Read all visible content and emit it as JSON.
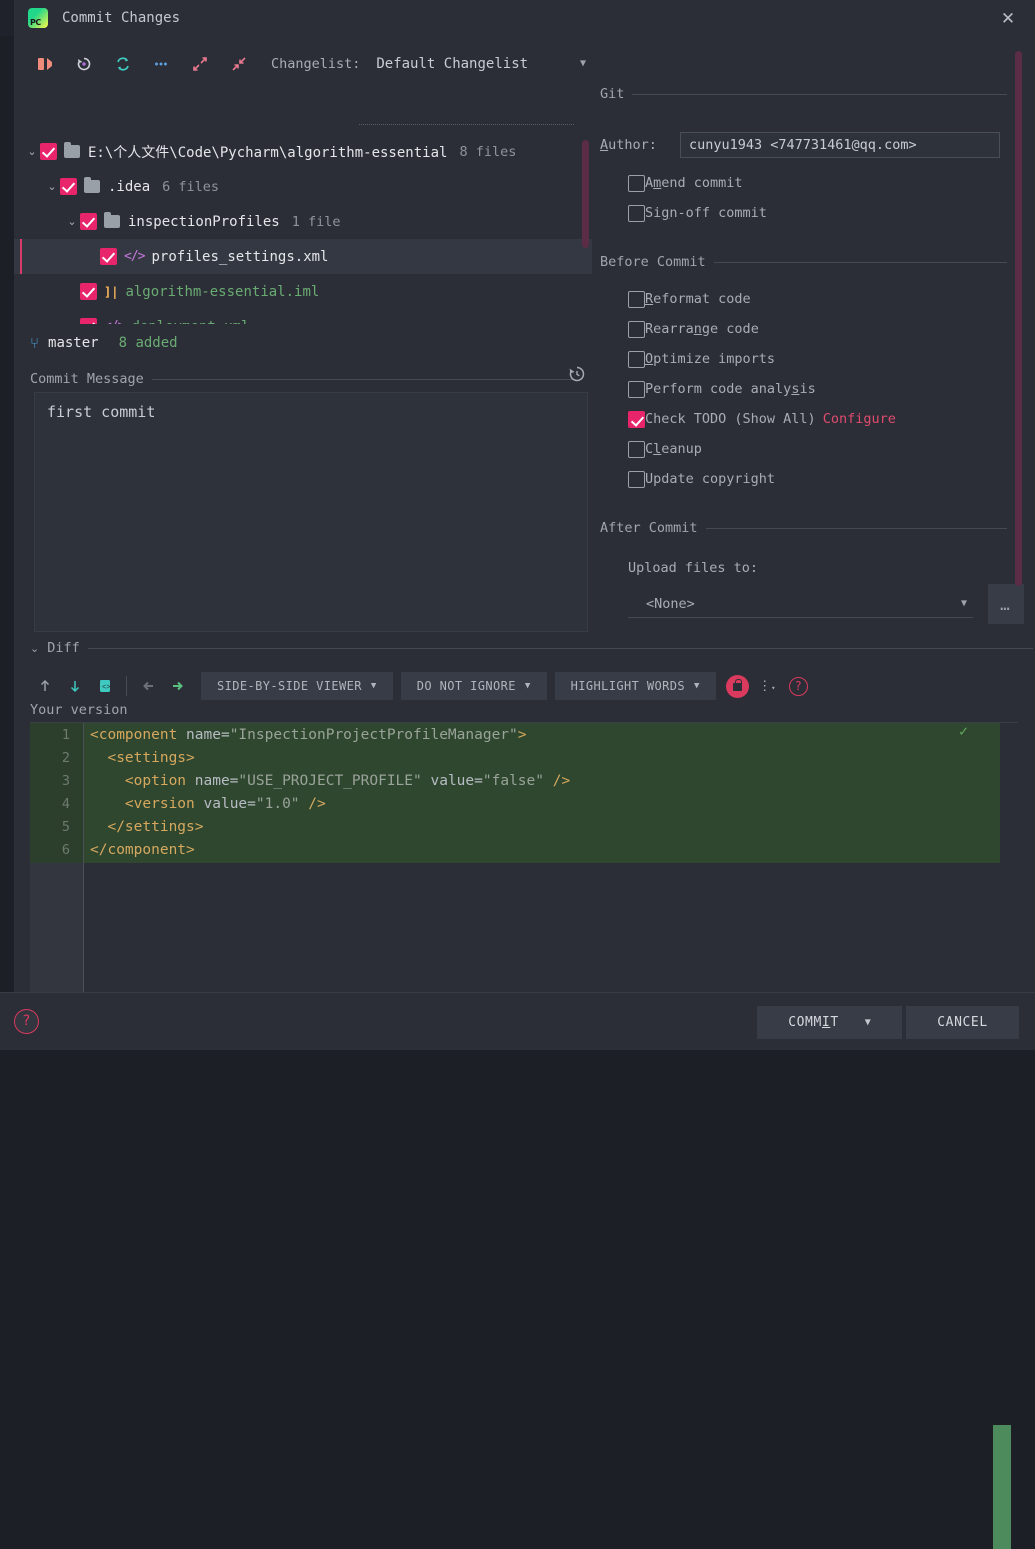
{
  "window": {
    "title": "Commit Changes",
    "app_icon": "pycharm-logo",
    "close_icon": "✕"
  },
  "toolbar": {
    "icons": [
      "show-diff-icon",
      "revert-icon",
      "refresh-icon",
      "more-icon",
      "expand-all-icon",
      "collapse-all-icon"
    ],
    "changelist_label": "Changelist:",
    "changelist_value": "Default Changelist",
    "caret": "▼"
  },
  "tree": {
    "rows": [
      {
        "arrow": "⌄",
        "icon": "folder-icon",
        "label": "E:\\个人文件\\Code\\Pycharm\\algorithm-essential",
        "count": "8 files",
        "indent": 0,
        "checked": true,
        "selected": false,
        "style": "white"
      },
      {
        "arrow": "⌄",
        "icon": "folder-icon",
        "label": ".idea",
        "count": "6 files",
        "indent": 1,
        "checked": true,
        "selected": false,
        "style": "white"
      },
      {
        "arrow": "⌄",
        "icon": "folder-icon",
        "label": "inspectionProfiles",
        "count": "1 file",
        "indent": 2,
        "checked": true,
        "selected": false,
        "style": "white"
      },
      {
        "arrow": "",
        "icon": "xml-file-icon",
        "label": "profiles_settings.xml",
        "count": "",
        "indent": 3,
        "checked": true,
        "selected": true,
        "style": "white"
      },
      {
        "arrow": "",
        "icon": "iml-file-icon",
        "label": "algorithm-essential.iml",
        "count": "",
        "indent": 2,
        "checked": true,
        "selected": false,
        "style": "green"
      },
      {
        "arrow": "",
        "icon": "xml-file-icon",
        "label": "deployment.xml",
        "count": "",
        "indent": 2,
        "checked": true,
        "selected": false,
        "style": "green"
      }
    ]
  },
  "branch": {
    "icon": "git-branch-icon",
    "name": "master",
    "status": "8 added"
  },
  "commit_message": {
    "section_title": "Commit Message",
    "title_mnemonic": "C",
    "history_icon": "history-icon",
    "value": "first commit"
  },
  "git": {
    "section_title": "Git",
    "author_label": "Author:",
    "author_mnemonic": "A",
    "author_value": "cunyu1943 <747731461@qq.com>",
    "checkboxes": [
      {
        "label": "Amend commit",
        "mnemonic": "m",
        "checked": false
      },
      {
        "label": "Sign-off commit",
        "mnemonic": "g",
        "checked": false
      }
    ]
  },
  "before_commit": {
    "section_title": "Before Commit",
    "checkboxes": [
      {
        "label": "Reformat code",
        "mnemonic": "R",
        "checked": false,
        "link": ""
      },
      {
        "label": "Rearrange code",
        "mnemonic": "n",
        "checked": false,
        "link": ""
      },
      {
        "label": "Optimize imports",
        "mnemonic": "O",
        "checked": false,
        "link": ""
      },
      {
        "label": "Perform code analysis",
        "mnemonic": "s",
        "checked": false,
        "link": ""
      },
      {
        "label": "Check TODO (Show All)",
        "mnemonic": "",
        "checked": true,
        "link": "Configure"
      },
      {
        "label": "Cleanup",
        "mnemonic": "l",
        "checked": false,
        "link": ""
      },
      {
        "label": "Update copyright",
        "mnemonic": "",
        "checked": false,
        "link": ""
      }
    ]
  },
  "after_commit": {
    "section_title": "After Commit",
    "upload_label": "Upload files to:",
    "upload_value": "<None>",
    "caret": "▼",
    "more_button": "…"
  },
  "diff": {
    "section_title": "Diff",
    "collapse_arrow": "⌄",
    "nav_icons": [
      "previous-difference-icon",
      "next-difference-icon",
      "compare-file-icon",
      "accept-left-icon",
      "accept-right-icon"
    ],
    "combos": [
      {
        "label": "SIDE-BY-SIDE VIEWER",
        "caret": "▼"
      },
      {
        "label": "DO NOT IGNORE",
        "caret": "▼"
      },
      {
        "label": "HIGHLIGHT WORDS",
        "caret": "▼"
      }
    ],
    "lock_icon": "lock-icon",
    "kebab_icon": "settings-kebab-icon",
    "help_icon": "help-icon",
    "pane_label": "Your version",
    "ok_check": "✓",
    "code_lines": [
      {
        "n": "1",
        "segments": [
          {
            "t": "<component ",
            "c": "tag"
          },
          {
            "t": "name=",
            "c": "attr"
          },
          {
            "t": "\"InspectionProjectProfileManager\"",
            "c": "str"
          },
          {
            "t": ">",
            "c": "tag"
          }
        ]
      },
      {
        "n": "2",
        "segments": [
          {
            "t": "  <settings>",
            "c": "tag"
          }
        ]
      },
      {
        "n": "3",
        "segments": [
          {
            "t": "    <option ",
            "c": "tag"
          },
          {
            "t": "name=",
            "c": "attr"
          },
          {
            "t": "\"USE_PROJECT_PROFILE\" ",
            "c": "str"
          },
          {
            "t": "value=",
            "c": "attr"
          },
          {
            "t": "\"false\" ",
            "c": "str"
          },
          {
            "t": "/>",
            "c": "tag"
          }
        ]
      },
      {
        "n": "4",
        "segments": [
          {
            "t": "    <version ",
            "c": "tag"
          },
          {
            "t": "value=",
            "c": "attr"
          },
          {
            "t": "\"1.0\" ",
            "c": "str"
          },
          {
            "t": "/>",
            "c": "tag"
          }
        ]
      },
      {
        "n": "5",
        "segments": [
          {
            "t": "  </settings>",
            "c": "tag"
          }
        ]
      },
      {
        "n": "6",
        "segments": [
          {
            "t": "</component>",
            "c": "tag"
          }
        ]
      }
    ]
  },
  "footer": {
    "help_icon": "help-icon",
    "commit_label": "COMMIT",
    "commit_mnemonic": "I",
    "commit_caret": "▼",
    "cancel_label": "CANCEL"
  },
  "colors": {
    "accent_pink": "#e8256b",
    "link_red": "#e04b6e",
    "diff_added_bg": "#2e472e",
    "scrollbar_maroon": "#5b2c45",
    "green_text": "#6aab73"
  }
}
